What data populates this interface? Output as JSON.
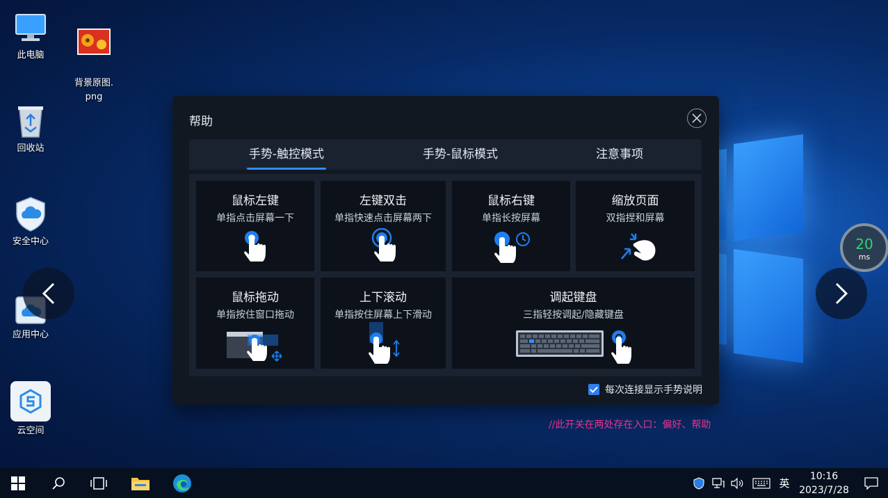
{
  "desktop": {
    "icons": [
      {
        "label": "此电脑"
      },
      {
        "label": "背景原图.\npng"
      },
      {
        "label": "回收站"
      },
      {
        "label": "安全中心"
      },
      {
        "label": "应用中心"
      },
      {
        "label": "云空间"
      }
    ]
  },
  "latency": {
    "value": "20",
    "unit": "ms",
    "color": "#2fd56a"
  },
  "dialog": {
    "title": "帮助",
    "tabs": [
      {
        "label": "手势-触控模式",
        "active": true
      },
      {
        "label": "手势-鼠标模式",
        "active": false
      },
      {
        "label": "注意事项",
        "active": false
      }
    ],
    "cards": [
      {
        "title": "鼠标左键",
        "desc": "单指点击屏幕一下",
        "icon": "single-tap-icon"
      },
      {
        "title": "左键双击",
        "desc": "单指快速点击屏幕两下",
        "icon": "double-tap-icon"
      },
      {
        "title": "鼠标右键",
        "desc": "单指长按屏幕",
        "icon": "long-press-icon"
      },
      {
        "title": "缩放页面",
        "desc": "双指捏和屏幕",
        "icon": "pinch-icon"
      },
      {
        "title": "鼠标拖动",
        "desc": "单指按住窗口拖动",
        "icon": "drag-icon"
      },
      {
        "title": "上下滚动",
        "desc": "单指按住屏幕上下滑动",
        "icon": "scroll-icon"
      },
      {
        "title": "调起键盘",
        "desc": "三指轻按调起/隐藏键盘",
        "icon": "keyboard-icon"
      }
    ],
    "checkbox": {
      "label": "每次连接显示手势说明",
      "checked": true
    },
    "accent": "#2f8fff"
  },
  "note": "//此开关在两处存在入口：偏好、帮助",
  "taskbar": {
    "ime": "英",
    "time": "10:16",
    "date": "2023/7/28"
  }
}
